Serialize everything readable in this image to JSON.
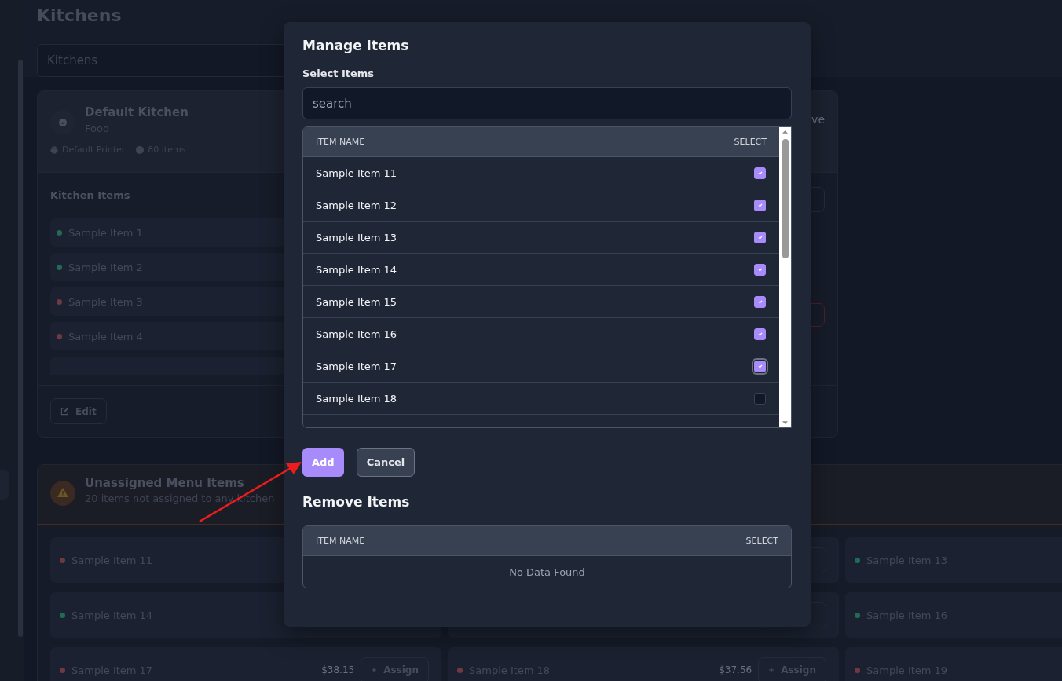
{
  "page": {
    "title": "Kitchens",
    "search_placeholder": "Kitchens"
  },
  "kitchen": {
    "name": "Default Kitchen",
    "type": "Food",
    "printer": "Default Printer",
    "count": "80 items",
    "status": "ve",
    "items_title": "Kitchen Items",
    "edit_label": "Edit",
    "items": [
      {
        "name": "Sample Item 1",
        "color": "#1f6b55"
      },
      {
        "name": "Sample Item 2",
        "color": "#1f6b55"
      },
      {
        "name": "Sample Item 3",
        "color": "#70393f"
      },
      {
        "name": "Sample Item 4",
        "color": "#70393f"
      }
    ]
  },
  "unassigned": {
    "title": "Unassigned Menu Items",
    "subtitle": "20 items not assigned to any kitchen",
    "items": [
      {
        "kind": "item",
        "name": "Sample Item 11",
        "color": "#70393f"
      },
      {
        "kind": "hidden"
      },
      {
        "kind": "item",
        "name": "Sample Item 13",
        "color": "#1f6b55"
      },
      {
        "kind": "item",
        "name": "Sample Item 14",
        "color": "#1f6b55"
      },
      {
        "kind": "hidden"
      },
      {
        "kind": "item",
        "name": "Sample Item 16",
        "color": "#1f6b55"
      },
      {
        "kind": "item",
        "name": "Sample Item 17",
        "color": "#70393f",
        "price": "$38.15",
        "action": "Assign"
      },
      {
        "kind": "item",
        "name": "Sample Item 18",
        "color": "#70393f",
        "price": "$37.56",
        "action": "Assign"
      },
      {
        "kind": "item",
        "name": "Sample Item 19",
        "color": "#70393f"
      }
    ]
  },
  "modal": {
    "title": "Manage Items",
    "select_label": "Select Items",
    "search_placeholder": "search",
    "select_table": {
      "columns": [
        "ITEM NAME",
        "SELECT"
      ],
      "rows": [
        {
          "name": "Sample Item 11",
          "checked": true,
          "focused": false
        },
        {
          "name": "Sample Item 12",
          "checked": true,
          "focused": false
        },
        {
          "name": "Sample Item 13",
          "checked": true,
          "focused": false
        },
        {
          "name": "Sample Item 14",
          "checked": true,
          "focused": false
        },
        {
          "name": "Sample Item 15",
          "checked": true,
          "focused": false
        },
        {
          "name": "Sample Item 16",
          "checked": true,
          "focused": false
        },
        {
          "name": "Sample Item 17",
          "checked": true,
          "focused": true
        },
        {
          "name": "Sample Item 18",
          "checked": false,
          "focused": false
        }
      ]
    },
    "buttons": [
      {
        "label": "Add",
        "kind": "primary"
      },
      {
        "label": "Cancel",
        "kind": "secondary"
      }
    ],
    "remove_title": "Remove Items",
    "remove_table": {
      "columns": [
        "ITEM NAME",
        "SELECT"
      ],
      "empty": "No Data Found"
    }
  }
}
